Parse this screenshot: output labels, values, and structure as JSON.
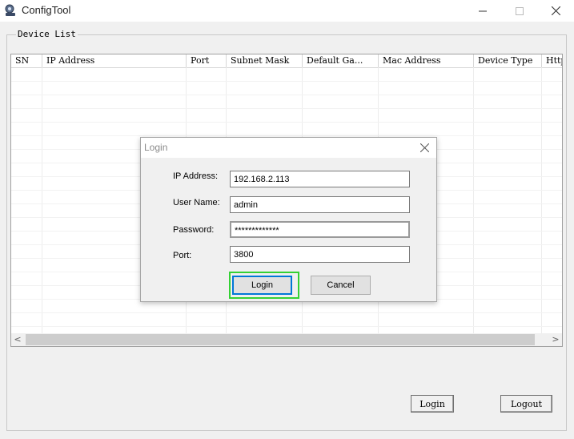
{
  "window": {
    "title": "ConfigTool",
    "app_icon": "configtool-icon",
    "minimize_glyph": "—",
    "maximize_glyph": "☐",
    "close_glyph": "✕"
  },
  "device_list": {
    "group_label": "Device List",
    "columns": [
      "SN",
      "IP Address",
      "Port",
      "Subnet Mask",
      "Default Ga...",
      "Mac Address",
      "Device Type",
      "Http"
    ],
    "rows": [],
    "scroll_left_glyph": "<",
    "scroll_right_glyph": ">"
  },
  "login_dialog": {
    "title": "Login",
    "ip_label": "IP Address:",
    "ip_value": "192.168.2.113",
    "user_label": "User Name:",
    "user_value": "admin",
    "password_label": "Password:",
    "password_value": "*************",
    "port_label": "Port:",
    "port_value": "3800",
    "login_button": "Login",
    "cancel_button": "Cancel"
  },
  "bottom": {
    "login_button": "Login",
    "logout_button": "Logout"
  },
  "colors": {
    "highlight": "#34d134",
    "window_bg": "#f0f0f0"
  }
}
